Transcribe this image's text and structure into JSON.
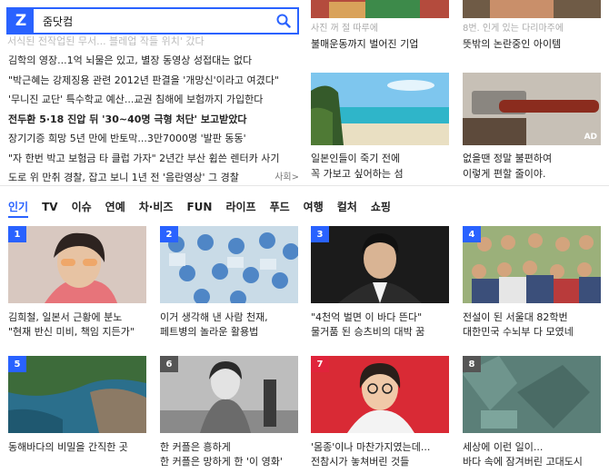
{
  "search": {
    "logo": "Z",
    "query": "줌닷컴"
  },
  "faded_line": "서식된 전작업된 무서... 블레업 작들 위치' 갔다",
  "news": [
    {
      "text": "김학의 영장...1억 뇌물은 있고, 별장 동영상 성접대는 없다",
      "bold": false
    },
    {
      "text": "\"박근혜는 강제징용 관련 2012년 판결을 '개망신'이라고 여겼다\"",
      "bold": false
    },
    {
      "text": "'무니진 교단' 특수학교 예산...교권 침해에 보험까지 가입한다",
      "bold": false
    },
    {
      "text": "전두환 5·18 진압 뒤 '30~40명 극형 처단' 보고받았다",
      "bold": true
    },
    {
      "text": "장기기증 희망 5년 만에 반토막...3만7000명 '발판 동동'",
      "bold": false
    },
    {
      "text": "\"자 한번 박고 보험금 타 클럽 가자\" 2년간 부산 휩쓴 렌터카 사기",
      "bold": false
    },
    {
      "text": "도로 위 만취 경찰, 잡고 보니 1년 전 '음란영상' 그 경찰",
      "bold": false,
      "section": "사회>"
    }
  ],
  "top_cards": [
    {
      "caption": "불매운동까지 벌어진 기업",
      "top_caption": "사진 꺼 절 따루에"
    },
    {
      "caption": "뜻밖의 논란중인 아이템",
      "top_caption": "8번. 인게 있는 다리마주에"
    },
    {
      "caption": "일본인들이 죽기 전에\n꼭 가보고 싶어하는 섬"
    },
    {
      "caption": "없을땐 정말 불편하여\n이렇게 편할 줄이야.",
      "badge": "AD"
    }
  ],
  "tabs": [
    "인기",
    "TV",
    "이슈",
    "연예",
    "차·비즈",
    "FUN",
    "라이프",
    "푸드",
    "여행",
    "컬처",
    "쇼핑"
  ],
  "grid": [
    {
      "rank": "1",
      "caption": "김희철, 일본서 근황에 분노\n\"현재 반신 미비, 책임 지든가\""
    },
    {
      "rank": "2",
      "caption": "이거 생각해 낸 사람 천재,\n페트병의 놀라운 활용법"
    },
    {
      "rank": "3",
      "caption": "\"4천억 벌면 이 바다 뜬다\"\n물거품 된 승츠비의 대박 꿈"
    },
    {
      "rank": "4",
      "caption": "전설이 된 서울대 82학번\n대한민국 수뇌부 다 모였네"
    },
    {
      "rank": "5",
      "caption": "동해바다의 비밀을 간직한 곳"
    },
    {
      "rank": "6",
      "caption": "한 커플은 흥하게\n한 커플은 망하게 한 '이 영화'"
    },
    {
      "rank": "7",
      "caption": "'몸종'이나 마찬가지였는데...\n전참시가 놓쳐버린 것들"
    },
    {
      "rank": "8",
      "caption": "세상에 이런 일이...\n바다 속에 잠겨버린 고대도시"
    }
  ],
  "colors": {
    "accent": "#2962ff",
    "rank_red": "#e0243b"
  }
}
